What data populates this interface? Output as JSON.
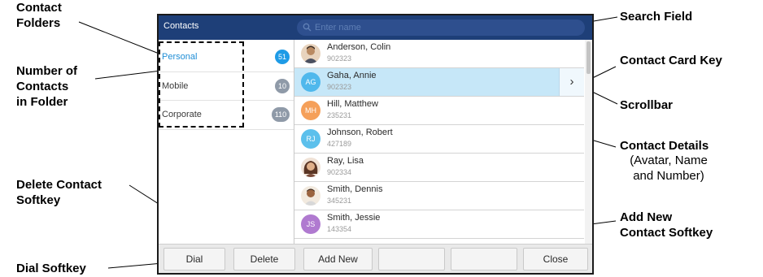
{
  "callouts": {
    "contact_folders": [
      "Contact",
      "Folders"
    ],
    "number_of_contacts": [
      "Number of",
      "Contacts",
      "in Folder"
    ],
    "delete_softkey": [
      "Delete Contact",
      "Softkey"
    ],
    "dial_softkey": "Dial Softkey",
    "search_field": "Search Field",
    "contact_card_key": "Contact Card Key",
    "scrollbar": "Scrollbar",
    "contact_details": "Contact Details",
    "contact_details_sub": [
      "(Avatar, Name",
      "and Number)"
    ],
    "add_new_softkey": [
      "Add New",
      "Contact Softkey"
    ]
  },
  "screen": {
    "title": "Contacts",
    "search_placeholder": "Enter name",
    "folders": [
      {
        "name": "Personal",
        "count": "51",
        "active": true
      },
      {
        "name": "Mobile",
        "count": "10",
        "active": false
      },
      {
        "name": "Corporate",
        "count": "110",
        "active": false
      }
    ],
    "contacts": [
      {
        "name": "Anderson, Colin",
        "number": "902323",
        "initials": "",
        "avatar": "photo",
        "color": "#d9b48f"
      },
      {
        "name": "Gaha, Annie",
        "number": "902323",
        "initials": "AG",
        "avatar": "initials",
        "color": "#4fb8ec",
        "selected": true
      },
      {
        "name": "Hill, Matthew",
        "number": "235231",
        "initials": "MH",
        "avatar": "initials",
        "color": "#f5a05a"
      },
      {
        "name": "Johnson, Robert",
        "number": "427189",
        "initials": "RJ",
        "avatar": "initials",
        "color": "#5cc0ec"
      },
      {
        "name": "Ray, Lisa",
        "number": "902334",
        "initials": "",
        "avatar": "photo",
        "color": "#c98a68"
      },
      {
        "name": "Smith, Dennis",
        "number": "345231",
        "initials": "",
        "avatar": "photo",
        "color": "#a8714e"
      },
      {
        "name": "Smith, Jessie",
        "number": "143354",
        "initials": "JS",
        "avatar": "initials",
        "color": "#b07ad0"
      }
    ],
    "softkeys": [
      "Dial",
      "Delete",
      "Add New",
      "",
      "",
      "Close"
    ],
    "colors": {
      "titlebar": "#1e3f78",
      "selected_row": "#c6e7f8",
      "active_folder": "#1e8dd6"
    }
  }
}
